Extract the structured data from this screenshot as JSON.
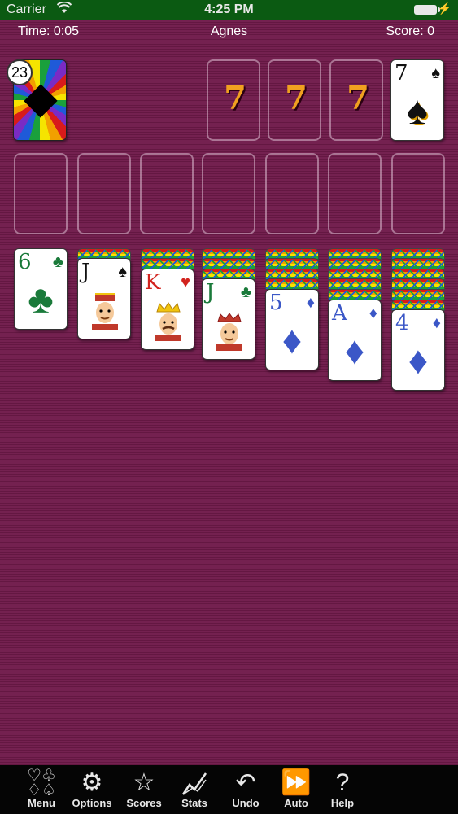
{
  "status_bar": {
    "carrier": "Carrier",
    "time": "4:25 PM"
  },
  "header": {
    "time": "Time: 0:05",
    "game": "Agnes",
    "score": "Score: 0"
  },
  "stock": {
    "count": "23"
  },
  "foundations": [
    "7",
    "7",
    "7"
  ],
  "foundation_card": {
    "rank": "7",
    "suit": "♠"
  },
  "tableau": [
    {
      "rank": "6",
      "suit": "♣"
    },
    {
      "rank": "J",
      "suit": "♠"
    },
    {
      "rank": "K",
      "suit": "♥"
    },
    {
      "rank": "J",
      "suit": "♣"
    },
    {
      "rank": "5",
      "suit": "♦"
    },
    {
      "rank": "A",
      "suit": "♦"
    },
    {
      "rank": "4",
      "suit": "♦"
    }
  ],
  "toolbar": {
    "menu": "Menu",
    "options": "Options",
    "scores": "Scores",
    "stats": "Stats",
    "undo": "Undo",
    "auto": "Auto",
    "help": "Help"
  },
  "colors": {
    "felt": "#6f1a4a",
    "status_bar": "#0b5a12",
    "toolbar": "#050505",
    "foundation_number": "#f0a020"
  }
}
